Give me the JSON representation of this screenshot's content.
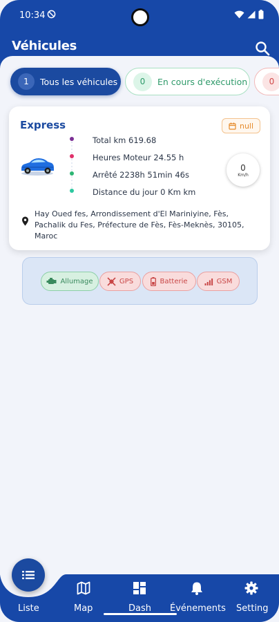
{
  "status_bar": {
    "time": "10:34"
  },
  "header": {
    "title": "Véhicules"
  },
  "filters": [
    {
      "count": "1",
      "label": "Tous les véhicules",
      "active": true
    },
    {
      "count": "0",
      "label": "En cours d'exécution",
      "active": false
    },
    {
      "count": "0",
      "label": "",
      "active": false
    }
  ],
  "vehicle": {
    "name": "Express",
    "date_badge": "null",
    "stats": {
      "total_km": "Total km 619.68",
      "engine_hours": "Heures Moteur 24.55 h",
      "stopped": "Arrêté  2238h 51min 46s",
      "day_distance": "Distance du jour 0 Km km"
    },
    "speed": {
      "value": "0",
      "unit": "Km/h"
    },
    "address": "Hay Oued fes, Arrondissement d'El Mariniyine, Fès, Pachalik du Fes, Préfecture de Fès, Fès-Meknès, 30105, Maroc"
  },
  "sensors": {
    "ignition": "Allumage",
    "gps": "GPS",
    "battery": "Batterie",
    "gsm": "GSM"
  },
  "nav": {
    "list": "Liste",
    "map": "Map",
    "dash": "Dash",
    "events": "Événements",
    "settings": "Setting"
  },
  "colors": {
    "primary": "#1748a8",
    "ok": "#3a8a5e",
    "alert": "#c84646",
    "warning": "#e58a2a"
  }
}
